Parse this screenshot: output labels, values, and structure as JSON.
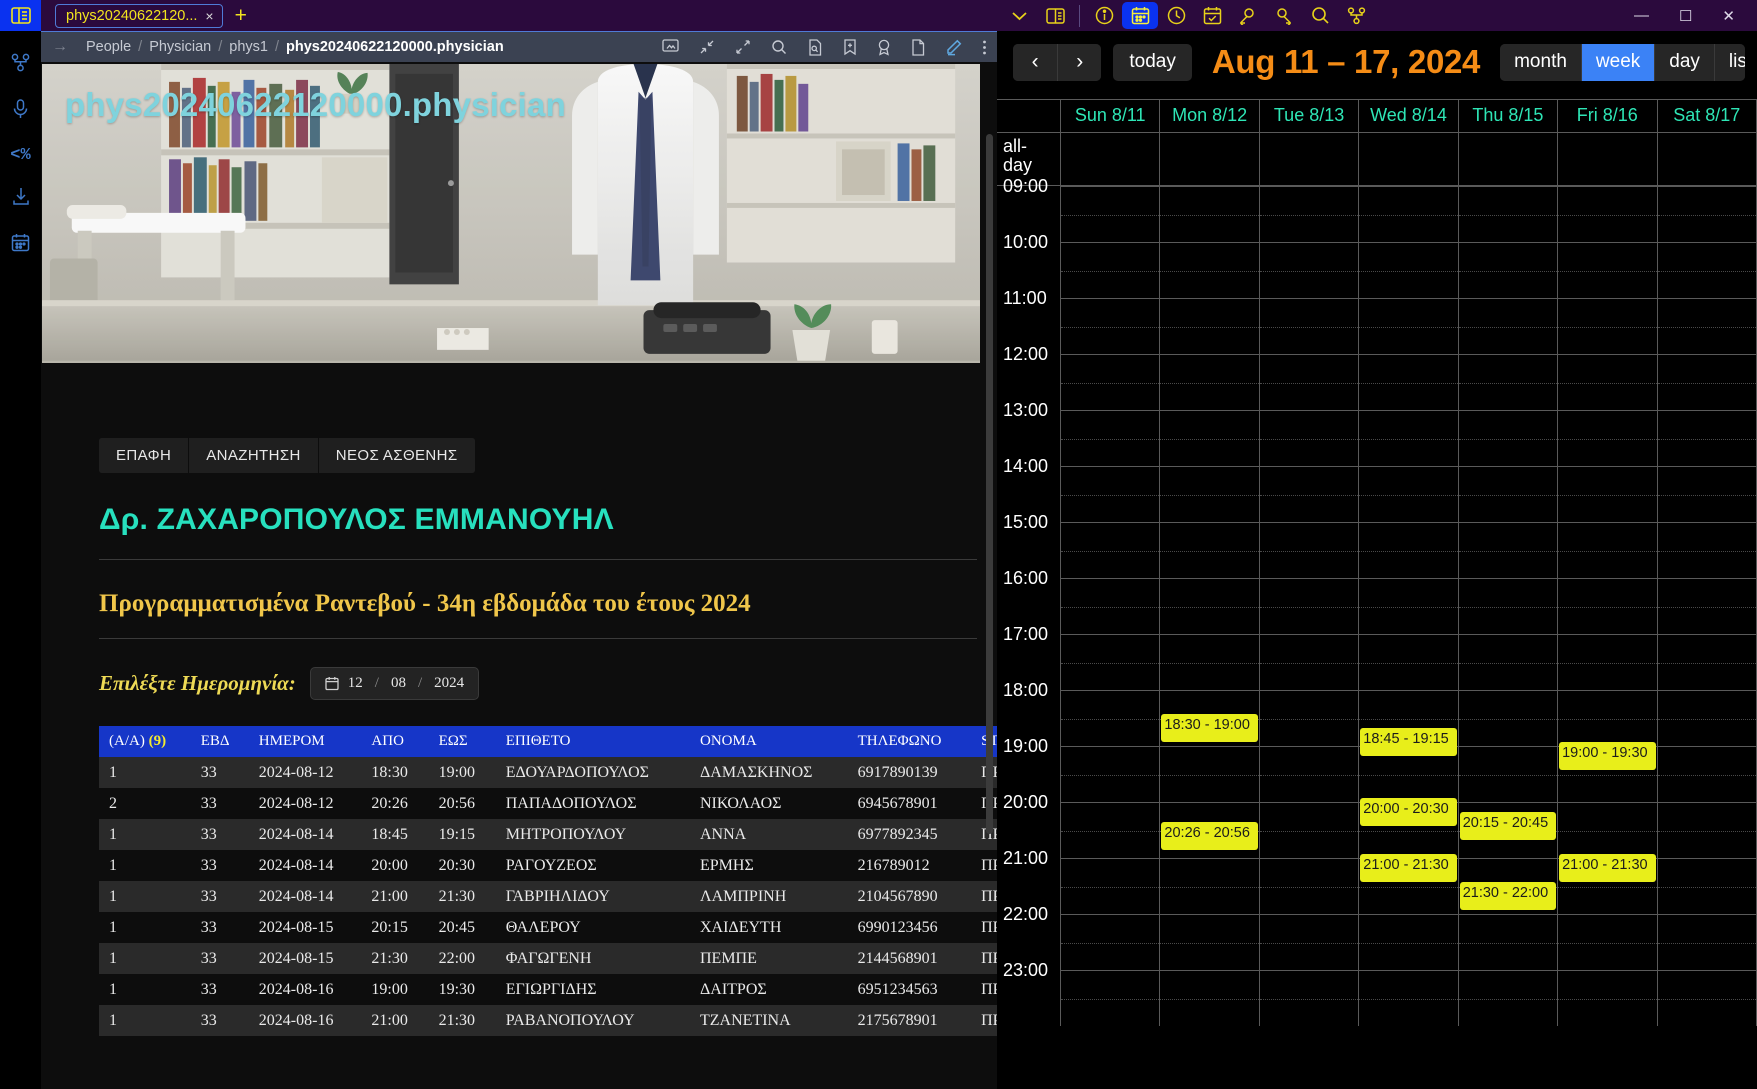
{
  "left_pane": {
    "tab": {
      "label": "phys20240622120...",
      "close": "×",
      "new_tab": "+"
    },
    "breadcrumb": {
      "items": [
        "People",
        "Physician",
        "phys1"
      ],
      "current": "phys20240622120000.physician",
      "separator": "/"
    },
    "hero_title": "phys20240622120000.physician",
    "buttons": [
      "ΕΠΑΦΗ",
      "ΑΝΑΖΗΤΗΣΗ",
      "ΝΕΟΣ ΑΣΘΕΝΗΣ"
    ],
    "heading1": "Δρ. ΖΑΧΑΡΟΠΟΥΛΟΣ ΕΜΜΑΝΟΥΗΛ",
    "heading2": "Προγραμματισμένα Ραντεβού - 34η εβδομάδα του έτους 2024",
    "date_label": "Επιλέξτε Ημερομηνία:",
    "date_value": {
      "day": "12",
      "month": "08",
      "year": "2024"
    },
    "table": {
      "count": "(9)",
      "headers": [
        "(Α/Α)",
        "ΕΒΔ",
        "ΗΜΕΡΟΜ",
        "ΑΠΟ",
        "ΕΩΣ",
        "ΕΠΙΘΕΤΟ",
        "ΟΝΟΜΑ",
        "ΤΗΛΕΦΩΝΟ",
        "STATUS"
      ],
      "rows": [
        {
          "aa": "1",
          "ebd": "33",
          "date": "2024-08-12",
          "from": "18:30",
          "to": "19:00",
          "last": "ΕΔΟΥΑΡΔΟΠΟΥΛΟΣ",
          "first": "ΔΑΜΑΣΚΗΝΟΣ",
          "phone": "6917890139",
          "status": "ΠΡΟΓ"
        },
        {
          "aa": "2",
          "ebd": "33",
          "date": "2024-08-12",
          "from": "20:26",
          "to": "20:56",
          "last": "ΠΑΠΑΔΟΠΟΥΛΟΣ",
          "first": "ΝΙΚΟΛΑΟΣ",
          "phone": "6945678901",
          "status": "ΠΡΟΓ"
        },
        {
          "aa": "1",
          "ebd": "33",
          "date": "2024-08-14",
          "from": "18:45",
          "to": "19:15",
          "last": "ΜΗΤΡΟΠΟΥΛΟΥ",
          "first": "ΑΝΝΑ",
          "phone": "6977892345",
          "status": "ΠΡΟΓ"
        },
        {
          "aa": "1",
          "ebd": "33",
          "date": "2024-08-14",
          "from": "20:00",
          "to": "20:30",
          "last": "ΡΑΓΟΥΖΕΟΣ",
          "first": "ΕΡΜΗΣ",
          "phone": "216789012",
          "status": "ΠΡΟΓ"
        },
        {
          "aa": "1",
          "ebd": "33",
          "date": "2024-08-14",
          "from": "21:00",
          "to": "21:30",
          "last": "ΓΑΒΡΙΗΛΙΔΟΥ",
          "first": "ΛΑΜΠΡΙΝΗ",
          "phone": "2104567890",
          "status": "ΠΡΟΓ"
        },
        {
          "aa": "1",
          "ebd": "33",
          "date": "2024-08-15",
          "from": "20:15",
          "to": "20:45",
          "last": "ΘΑΛΕΡΟΥ",
          "first": "ΧΑΙΔΕΥΤΗ",
          "phone": "6990123456",
          "status": "ΠΡΟΓ"
        },
        {
          "aa": "1",
          "ebd": "33",
          "date": "2024-08-15",
          "from": "21:30",
          "to": "22:00",
          "last": "ΦΑΓΩΓΕΝΗ",
          "first": "ΠΕΜΠΕ",
          "phone": "2144568901",
          "status": "ΠΡΟΓ"
        },
        {
          "aa": "1",
          "ebd": "33",
          "date": "2024-08-16",
          "from": "19:00",
          "to": "19:30",
          "last": "ΕΓΙΩΡΓΙΔΗΣ",
          "first": "ΔΑΙΤΡΟΣ",
          "phone": "6951234563",
          "status": "ΠΡΟΓ"
        },
        {
          "aa": "1",
          "ebd": "33",
          "date": "2024-08-16",
          "from": "21:00",
          "to": "21:30",
          "last": "ΡΑΒΑΝΟΠΟΥΛΟΥ",
          "first": "ΤΖΑΝΕΤΙΝΑ",
          "phone": "2175678901",
          "status": "ΠΡΟΓ"
        }
      ]
    }
  },
  "right_pane": {
    "window_controls": {
      "minimize": "—",
      "maximize": "☐",
      "close": "✕"
    },
    "toolbar": {
      "prev": "‹",
      "next": "›",
      "today": "today",
      "title": "Aug 11 – 17, 2024",
      "views": [
        {
          "label": "month",
          "selected": false
        },
        {
          "label": "week",
          "selected": true
        },
        {
          "label": "day",
          "selected": false
        },
        {
          "label": "list",
          "selected": false
        }
      ]
    },
    "grid": {
      "allday_label": "all-day",
      "days": [
        "Sun 8/11",
        "Mon 8/12",
        "Tue 8/13",
        "Wed 8/14",
        "Thu 8/15",
        "Fri 8/16",
        "Sat 8/17"
      ],
      "times": [
        "09:00",
        "10:00",
        "11:00",
        "12:00",
        "13:00",
        "14:00",
        "15:00",
        "16:00",
        "17:00",
        "18:00",
        "19:00",
        "20:00",
        "21:00",
        "22:00",
        "23:00"
      ]
    },
    "events": [
      {
        "day": 1,
        "label": "18:30 - 19:00",
        "start": "18:30",
        "end": "19:00"
      },
      {
        "day": 1,
        "label": "20:26 - 20:56",
        "start": "20:26",
        "end": "20:56"
      },
      {
        "day": 3,
        "label": "18:45 - 19:15",
        "start": "18:45",
        "end": "19:15"
      },
      {
        "day": 3,
        "label": "20:00 - 20:30",
        "start": "20:00",
        "end": "20:30"
      },
      {
        "day": 3,
        "label": "21:00 - 21:30",
        "start": "21:00",
        "end": "21:30"
      },
      {
        "day": 4,
        "label": "20:15 - 20:45",
        "start": "20:15",
        "end": "20:45"
      },
      {
        "day": 4,
        "label": "21:30 - 22:00",
        "start": "21:30",
        "end": "22:00"
      },
      {
        "day": 5,
        "label": "19:00 - 19:30",
        "start": "19:00",
        "end": "19:30"
      },
      {
        "day": 5,
        "label": "21:00 - 21:30",
        "start": "21:00",
        "end": "21:30"
      }
    ],
    "colors": {
      "accent_orange": "#f58c16",
      "event_bg": "#e8ee1a",
      "selected_view": "#3b82f6",
      "day_header": "#2ee6b6"
    }
  }
}
